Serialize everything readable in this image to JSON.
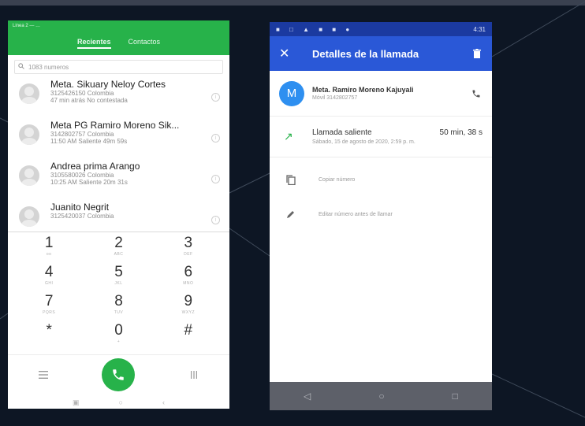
{
  "colors": {
    "background": "#0d1624",
    "dialer_green": "#27b24a",
    "details_blue": "#2a58d7",
    "details_status_blue": "#1b3aa0",
    "avatar_blue": "#2e8ff0",
    "nav_gray": "#5d6069"
  },
  "dialer": {
    "status_text": "Linea 2 — …",
    "tabs": [
      {
        "label": "Recientes",
        "active": true
      },
      {
        "label": "Contactos",
        "active": false
      }
    ],
    "search_placeholder": "1083 numeros",
    "contacts": [
      {
        "name": "Meta. Sikuary Neloy Cortes",
        "line1": "3125426150 Colombia",
        "line2": "47 min atrás No contestada"
      },
      {
        "name": "Meta PG Ramiro Moreno Sik...",
        "line1": "3142802757 Colombia",
        "line2": "11:50 AM Saliente 49m 59s"
      },
      {
        "name": "Andrea prima Arango",
        "line1": "3105580026 Colombia",
        "line2": "10:25 AM Saliente 20m 31s"
      },
      {
        "name": "Juanito Negrit",
        "line1": "3125420037 Colombia",
        "line2": ""
      }
    ],
    "keys": [
      {
        "digit": "1",
        "sub": "oo"
      },
      {
        "digit": "2",
        "sub": "ABC"
      },
      {
        "digit": "3",
        "sub": "DEF"
      },
      {
        "digit": "4",
        "sub": "GHI"
      },
      {
        "digit": "5",
        "sub": "JKL"
      },
      {
        "digit": "6",
        "sub": "MNO"
      },
      {
        "digit": "7",
        "sub": "PQRS"
      },
      {
        "digit": "8",
        "sub": "TUV"
      },
      {
        "digit": "9",
        "sub": "WXYZ"
      },
      {
        "digit": "*",
        "sub": ""
      },
      {
        "digit": "0",
        "sub": "+"
      },
      {
        "digit": "#",
        "sub": ""
      }
    ],
    "icons": {
      "menu": "menu-icon",
      "call": "phone-icon",
      "dialpad": "dialpad-icon",
      "nav_recent": "square-icon",
      "nav_home": "circle-icon",
      "nav_back": "back-icon"
    }
  },
  "details": {
    "status_time": "4:31",
    "title": "Detalles de la llamada",
    "contact": {
      "avatar_letter": "M",
      "name": "Meta. Ramiro Moreno Kajuyali",
      "subtitle": "Móvil 3142802757"
    },
    "call": {
      "type": "Llamada saliente",
      "duration": "50 min, 38 s",
      "date": "Sábado, 15 de agosto de 2020, 2:59 p. m."
    },
    "actions": [
      {
        "label": "Copiar número",
        "icon": "copy-icon"
      },
      {
        "label": "Editar número antes de llamar",
        "icon": "pencil-icon"
      }
    ]
  }
}
